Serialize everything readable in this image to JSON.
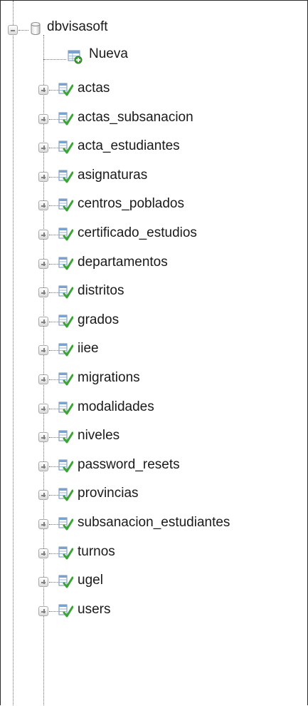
{
  "database": {
    "name": "dbvisasoft",
    "new_label": "Nueva",
    "icons": {
      "database": "database-cylinder-icon",
      "new": "new-table-icon",
      "table": "table-structure-icon"
    },
    "tables": [
      "actas",
      "actas_subsanacion",
      "acta_estudiantes",
      "asignaturas",
      "centros_poblados",
      "certificado_estudios",
      "departamentos",
      "distritos",
      "grados",
      "iiee",
      "migrations",
      "modalidades",
      "niveles",
      "password_resets",
      "provincias",
      "subsanacion_estudiantes",
      "turnos",
      "ugel",
      "users"
    ]
  }
}
